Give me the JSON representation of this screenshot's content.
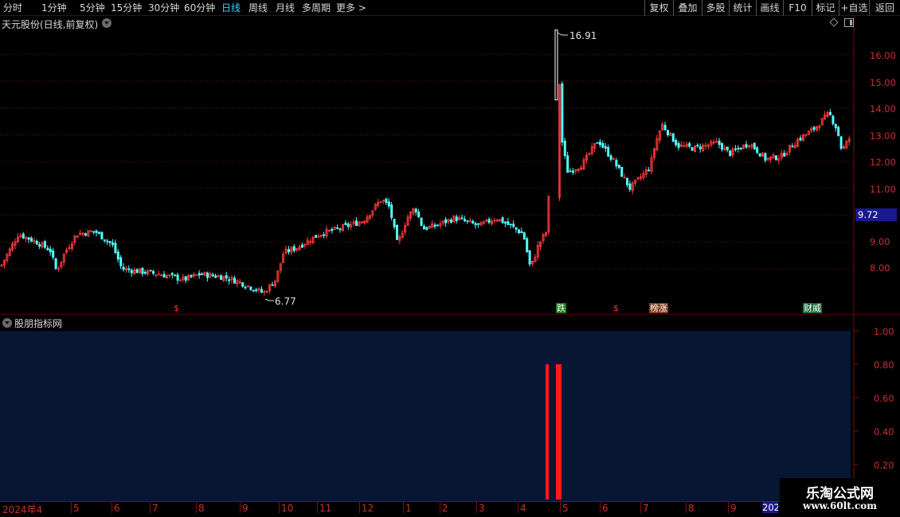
{
  "toolbar": {
    "periods": [
      "分时",
      "1分钟",
      "5分钟",
      "15分钟",
      "30分钟",
      "60分钟",
      "日线",
      "周线",
      "月线",
      "多周期",
      "更多 >"
    ],
    "active_period": "日线",
    "right_buttons": [
      "复权",
      "叠加",
      "多股",
      "统计",
      "画线",
      "F10",
      "标记",
      "+自选",
      "返回"
    ]
  },
  "main_chart": {
    "title": "天元股份(日线,前复权)",
    "price_axis": [
      "16.00",
      "15.00",
      "14.00",
      "13.00",
      "12.00",
      "11.00",
      "9.00",
      "8.00"
    ],
    "current_price": "9.72",
    "high_label": "16.91",
    "low_label": "6.77",
    "signals": [
      {
        "text": "$",
        "color": "#ff3030",
        "bg": ""
      },
      {
        "text": "跌",
        "color": "#ffffff",
        "bg": "#1a7a1a"
      },
      {
        "text": "$",
        "color": "#ff3030",
        "bg": ""
      },
      {
        "text": "榜涨",
        "color": "#ffffff",
        "bg": "#7a3a1a"
      },
      {
        "text": "财威",
        "color": "#ffffff",
        "bg": "#1a6a3a"
      }
    ],
    "colors": {
      "up": "#ff3b3b",
      "down": "#54ffff",
      "grid": "#7a1010",
      "axis": "#c83030"
    }
  },
  "indicator": {
    "title": "股朋指标网",
    "axis": [
      "1.00",
      "0.80",
      "0.60",
      "0.40",
      "0.20"
    ],
    "bar_value": 0.8,
    "bar_color": "#ff1a1a",
    "background": "#061633"
  },
  "time_axis": {
    "labels": [
      "2024年4",
      "5",
      "6",
      "7",
      "8",
      "9",
      "10",
      "11",
      "12",
      "1",
      "2",
      "3",
      "4",
      "5",
      "6",
      "7",
      "8",
      "9",
      "10"
    ],
    "year_box": "202"
  },
  "watermark": {
    "title": "乐淘公式网",
    "url": "www.60lt.com"
  }
}
